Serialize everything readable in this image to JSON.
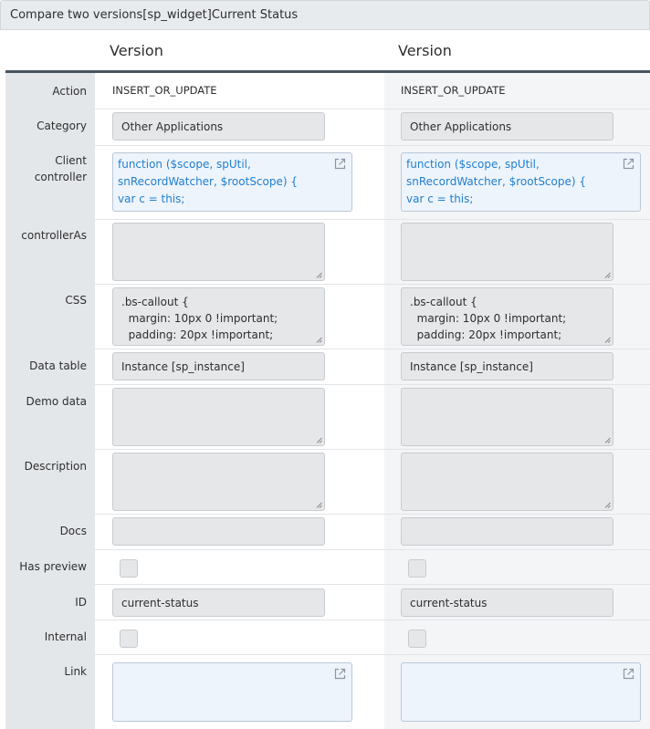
{
  "window": {
    "title": "Compare two versions[sp_widget]Current Status"
  },
  "columns": {
    "left_header": "Version",
    "right_header": "Version"
  },
  "labels": {
    "action": "Action",
    "category": "Category",
    "client_controller_1": "Client",
    "client_controller_2": "controller",
    "controller_as": "controllerAs",
    "css": "CSS",
    "data_table": "Data table",
    "demo_data": "Demo data",
    "description": "Description",
    "docs": "Docs",
    "has_preview": "Has preview",
    "id": "ID",
    "internal": "Internal",
    "link": "Link"
  },
  "left": {
    "action": "INSERT_OR_UPDATE",
    "category": "Other Applications",
    "client_controller": "function ($scope, spUtil, snRecordWatcher, $rootScope) {\nvar c = this;",
    "controller_as": "",
    "css": ".bs-callout {\n  margin: 10px 0 !important;\n  padding: 20px !important;",
    "data_table": "Instance [sp_instance]",
    "demo_data": "",
    "description": "",
    "docs": "",
    "has_preview": false,
    "id": "current-status",
    "internal": false,
    "link": ""
  },
  "right": {
    "action": "INSERT_OR_UPDATE",
    "category": "Other Applications",
    "client_controller": "function ($scope, spUtil, snRecordWatcher, $rootScope) {\nvar c = this;",
    "controller_as": "",
    "css": ".bs-callout {\n  margin: 10px 0 !important;\n  padding: 20px !important;",
    "data_table": "Instance [sp_instance]",
    "demo_data": "",
    "description": "",
    "docs": "",
    "has_preview": false,
    "id": "current-status",
    "internal": false,
    "link": ""
  },
  "icons": {
    "open_external": "external-link-icon",
    "resize": "resize-grip-icon"
  }
}
